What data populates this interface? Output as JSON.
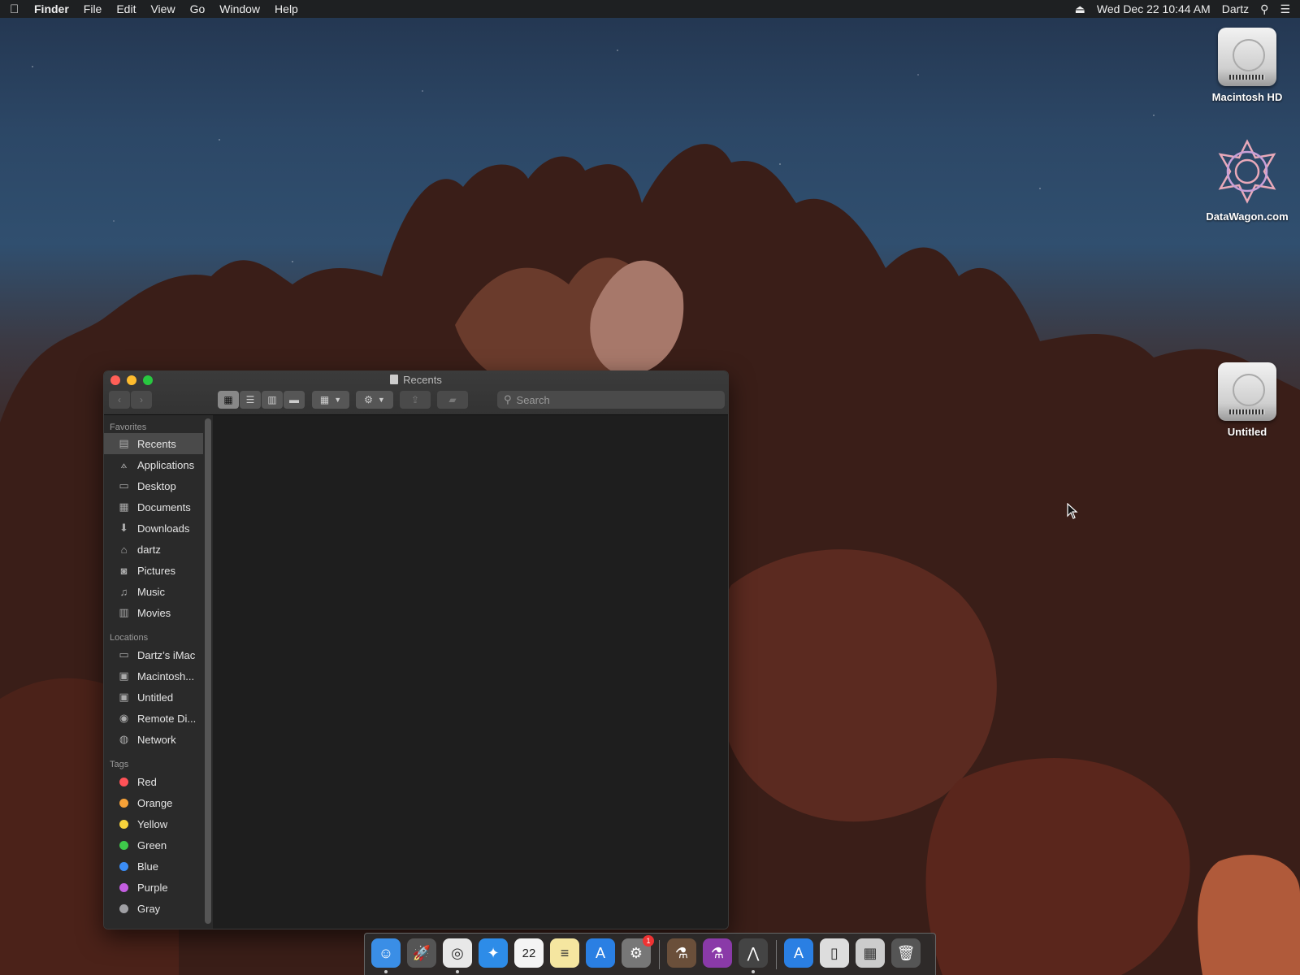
{
  "menubar": {
    "app_name": "Finder",
    "menus": [
      "File",
      "Edit",
      "View",
      "Go",
      "Window",
      "Help"
    ],
    "datetime": "Wed Dec 22  10:44 AM",
    "user": "Dartz"
  },
  "desktop_icons": [
    {
      "label": "Macintosh HD",
      "icon": "hard-drive-icon"
    },
    {
      "label": "DataWagon.com",
      "icon": "datawagon-icon"
    },
    {
      "label": "Untitled",
      "icon": "hard-drive-icon"
    }
  ],
  "window": {
    "title": "Recents",
    "search_placeholder": "Search",
    "sidebar": {
      "favorites_header": "Favorites",
      "favorites": [
        {
          "label": "Recents",
          "icon": "recents-icon",
          "glyph": "▤"
        },
        {
          "label": "Applications",
          "icon": "applications-icon",
          "glyph": "⟑"
        },
        {
          "label": "Desktop",
          "icon": "desktop-icon",
          "glyph": "▭"
        },
        {
          "label": "Documents",
          "icon": "documents-icon",
          "glyph": "▦"
        },
        {
          "label": "Downloads",
          "icon": "downloads-icon",
          "glyph": "⬇"
        },
        {
          "label": "dartz",
          "icon": "home-icon",
          "glyph": "⌂"
        },
        {
          "label": "Pictures",
          "icon": "pictures-icon",
          "glyph": "◙"
        },
        {
          "label": "Music",
          "icon": "music-icon",
          "glyph": "♫"
        },
        {
          "label": "Movies",
          "icon": "movies-icon",
          "glyph": "▥"
        }
      ],
      "locations_header": "Locations",
      "locations": [
        {
          "label": "Dartz’s iMac",
          "icon": "imac-icon",
          "glyph": "▭"
        },
        {
          "label": "Macintosh...",
          "icon": "hard-drive-icon",
          "glyph": "▣"
        },
        {
          "label": "Untitled",
          "icon": "hard-drive-icon",
          "glyph": "▣"
        },
        {
          "label": "Remote Di...",
          "icon": "remote-disc-icon",
          "glyph": "◉"
        },
        {
          "label": "Network",
          "icon": "network-icon",
          "glyph": "◍"
        }
      ],
      "tags_header": "Tags",
      "tags": [
        {
          "label": "Red",
          "color": "#ff5257"
        },
        {
          "label": "Orange",
          "color": "#f7a238"
        },
        {
          "label": "Yellow",
          "color": "#f8d33c"
        },
        {
          "label": "Green",
          "color": "#3ec84a"
        },
        {
          "label": "Blue",
          "color": "#3b8df6"
        },
        {
          "label": "Purple",
          "color": "#c35ee0"
        },
        {
          "label": "Gray",
          "color": "#a0a0a4"
        }
      ]
    }
  },
  "dock": {
    "apps": [
      {
        "name": "finder-icon",
        "color": "#3a8ee6",
        "glyph": "☺",
        "running": true
      },
      {
        "name": "launchpad-icon",
        "color": "#555",
        "glyph": "🚀",
        "running": false
      },
      {
        "name": "chrome-icon",
        "color": "#e8e8e8",
        "glyph": "◎",
        "running": true
      },
      {
        "name": "safari-icon",
        "color": "#2d8ce8",
        "glyph": "✦",
        "running": false
      },
      {
        "name": "calendar-icon",
        "color": "#f4f4f4",
        "glyph": "22",
        "running": false
      },
      {
        "name": "notes-icon",
        "color": "#f5e6a0",
        "glyph": "≡",
        "running": false
      },
      {
        "name": "app-store-icon",
        "color": "#2a7fe3",
        "glyph": "A",
        "running": false
      },
      {
        "name": "system-preferences-icon",
        "color": "#777",
        "glyph": "⚙",
        "running": false,
        "badge": "1"
      },
      {
        "name": "bottle-icon",
        "color": "#6a4f3a",
        "glyph": "⚗",
        "running": false
      },
      {
        "name": "potion-icon",
        "color": "#8a3aa8",
        "glyph": "⚗",
        "running": false
      },
      {
        "name": "utility-icon",
        "color": "#444",
        "glyph": "⋀",
        "running": true
      },
      {
        "name": "app-store-folder-icon",
        "color": "#2a7fe3",
        "glyph": "A",
        "running": false
      },
      {
        "name": "document-icon",
        "color": "#ddd",
        "glyph": "▯",
        "running": false
      },
      {
        "name": "preview-icon",
        "color": "#ccc",
        "glyph": "▦",
        "running": false
      },
      {
        "name": "trash-icon",
        "color": "#555",
        "glyph": "🗑",
        "running": false
      }
    ]
  }
}
